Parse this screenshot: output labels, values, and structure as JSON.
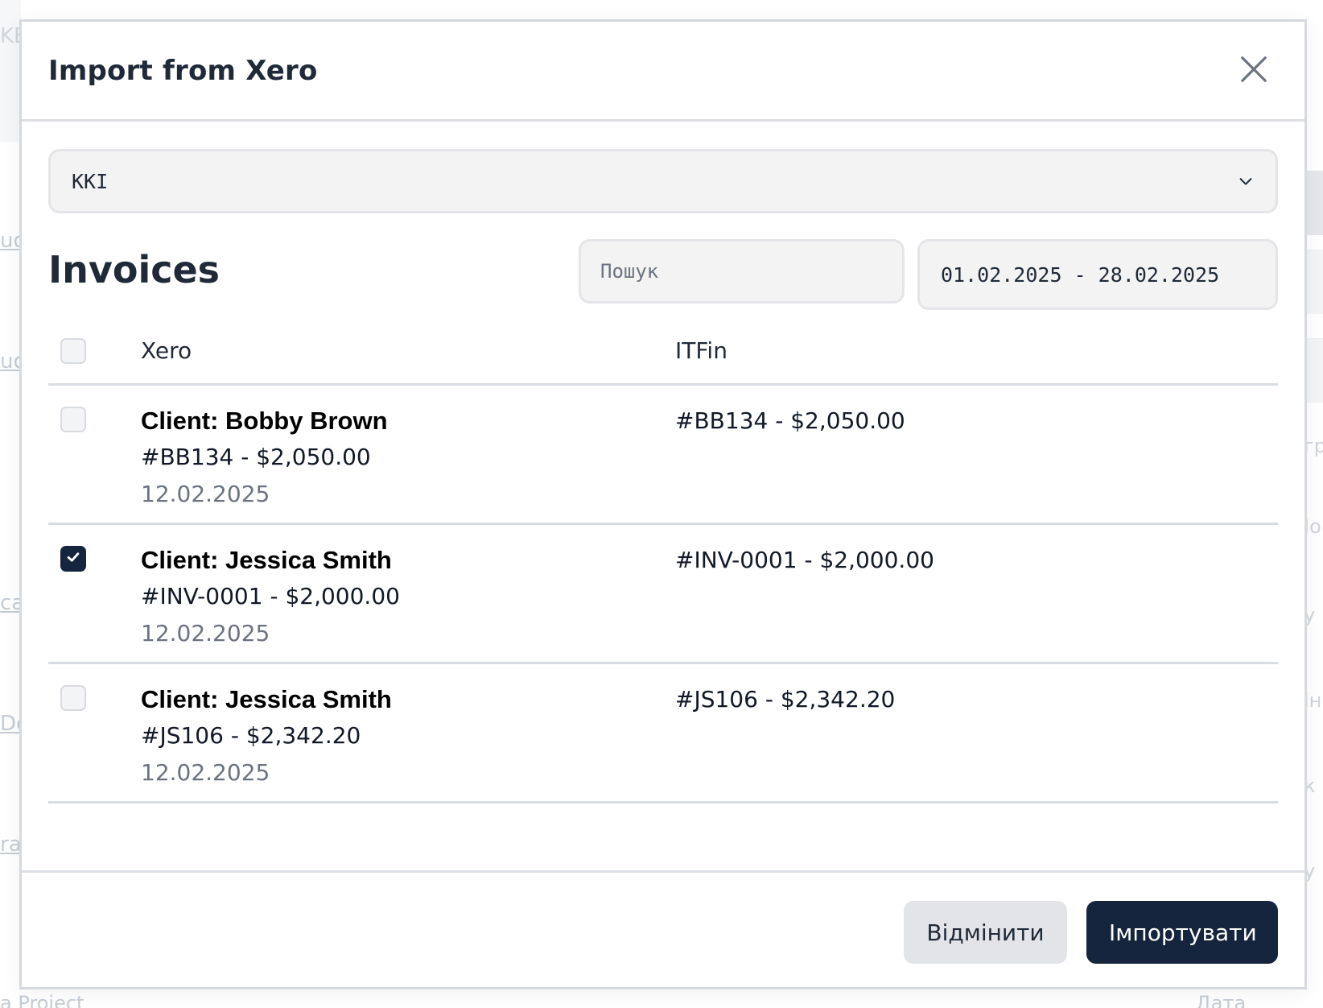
{
  "background": {
    "left_fragments": [
      "KE",
      "ud",
      "ud",
      "ca",
      "De",
      "ra"
    ],
    "right_fragments": [
      "гр",
      "Іо",
      "у",
      "ін",
      "к",
      "у"
    ],
    "bottom_left": "a Project",
    "bottom_right": "Дата"
  },
  "modal": {
    "title": "Import from Xero"
  },
  "organization_select": {
    "value": "KKI"
  },
  "section": {
    "title": "Invoices"
  },
  "search": {
    "placeholder": "Пошук",
    "value": ""
  },
  "date_range": {
    "value": "01.02.2025 - 28.02.2025"
  },
  "table": {
    "headers": {
      "xero": "Xero",
      "itfin": "ITFin"
    },
    "select_all_checked": false,
    "rows": [
      {
        "checked": false,
        "client": "Client: Bobby Brown",
        "invoice": "#BB134 - $2,050.00",
        "date": "12.02.2025",
        "itfin": "#BB134 - $2,050.00"
      },
      {
        "checked": true,
        "client": "Client: Jessica Smith",
        "invoice": "#INV-0001 - $2,000.00",
        "date": "12.02.2025",
        "itfin": "#INV-0001 - $2,000.00"
      },
      {
        "checked": false,
        "client": "Client: Jessica Smith",
        "invoice": "#JS106 - $2,342.20",
        "date": "12.02.2025",
        "itfin": "#JS106 - $2,342.20"
      }
    ]
  },
  "footer": {
    "cancel_label": "Відмінити",
    "import_label": "Імпортувати"
  },
  "icons": {
    "close": "close-icon",
    "dropdown": "chevron-down-icon",
    "check": "check-icon"
  },
  "colors": {
    "primary": "#14253d",
    "secondary_button": "#e2e4e8",
    "input_bg": "#f3f3f3",
    "muted_text": "#6b7280"
  }
}
